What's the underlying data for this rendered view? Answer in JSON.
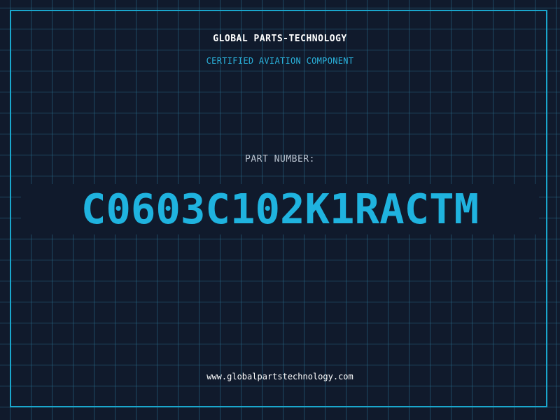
{
  "header": {
    "company_name": "GLOBAL PARTS-TECHNOLOGY",
    "tagline": "CERTIFIED AVIATION COMPONENT"
  },
  "part": {
    "label": "PART NUMBER:",
    "number": "C0603C102K1RACTM"
  },
  "footer": {
    "website": "www.globalpartstechnology.com"
  },
  "colors": {
    "background": "#101a2c",
    "grid": "#286e8c",
    "frame": "#1aa6cc",
    "accent": "#1fb3df",
    "text": "#ffffff",
    "label": "#b8c2cf"
  }
}
